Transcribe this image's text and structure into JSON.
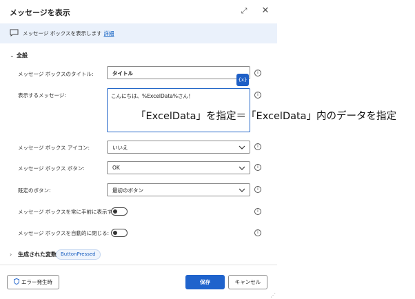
{
  "dialog": {
    "title": "メッセージを表示",
    "info": {
      "text": "メッセージ ボックスを表示します",
      "link": "詳細"
    },
    "section": "全般",
    "fields": {
      "title_label": "メッセージ ボックスのタイトル:",
      "title_value": "タイトル",
      "message_label": "表示するメッセージ:",
      "message_value": "こんにちは、%ExcelData%さん！",
      "var_button": "{x}",
      "icon_label": "メッセージ ボックス アイコン:",
      "icon_value": "いいえ",
      "buttons_label": "メッセージ ボックス ボタン:",
      "buttons_value": "OK",
      "default_label": "既定のボタン:",
      "default_value": "最初のボタン",
      "topmost_label": "メッセージ ボックスを常に手前に表示する:",
      "topmost_on": false,
      "autoclose_label": "メッセージ ボックスを自動的に閉じる:",
      "autoclose_on": false
    },
    "generated": {
      "label": "生成された変数",
      "badge": "ButtonPressed"
    },
    "footer": {
      "error_button": "エラー発生時",
      "save_button": "保存",
      "cancel_button": "キャンセル"
    }
  },
  "annotation": "「ExcelData」を指定＝「ExcelData」内のデータを指定",
  "colors": {
    "accent": "#1f63cc",
    "info_bg": "#eaf1fb"
  }
}
